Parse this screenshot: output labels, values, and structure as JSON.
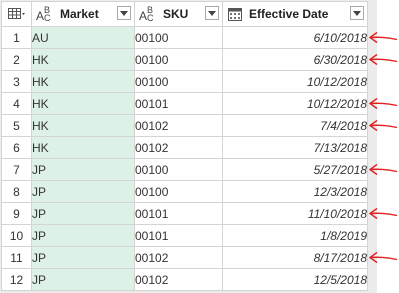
{
  "table": {
    "columns": [
      {
        "label": "Market",
        "type_icon": "text-type-icon"
      },
      {
        "label": "SKU",
        "type_icon": "text-type-icon"
      },
      {
        "label": "Effective Date",
        "type_icon": "calendar-type-icon"
      }
    ],
    "rows": [
      {
        "index": "1",
        "market": "AU",
        "sku": "00100",
        "date": "6/10/2018"
      },
      {
        "index": "2",
        "market": "HK",
        "sku": "00100",
        "date": "6/30/2018"
      },
      {
        "index": "3",
        "market": "HK",
        "sku": "00100",
        "date": "10/12/2018"
      },
      {
        "index": "4",
        "market": "HK",
        "sku": "00101",
        "date": "10/12/2018"
      },
      {
        "index": "5",
        "market": "HK",
        "sku": "00102",
        "date": "7/4/2018"
      },
      {
        "index": "6",
        "market": "HK",
        "sku": "00102",
        "date": "7/13/2018"
      },
      {
        "index": "7",
        "market": "JP",
        "sku": "00100",
        "date": "5/27/2018"
      },
      {
        "index": "8",
        "market": "JP",
        "sku": "00100",
        "date": "12/3/2018"
      },
      {
        "index": "9",
        "market": "JP",
        "sku": "00101",
        "date": "11/10/2018"
      },
      {
        "index": "10",
        "market": "JP",
        "sku": "00101",
        "date": "1/8/2019"
      },
      {
        "index": "11",
        "market": "JP",
        "sku": "00102",
        "date": "8/17/2018"
      },
      {
        "index": "12",
        "market": "JP",
        "sku": "00102",
        "date": "12/5/2018"
      }
    ]
  },
  "colors": {
    "selected_column": "#ddf1e6",
    "annotation_arrow": "#e02020",
    "grid_border": "#d4d4d4"
  },
  "annotations": {
    "arrow_rows": [
      "1",
      "2",
      "4",
      "5",
      "7",
      "9",
      "11"
    ]
  }
}
